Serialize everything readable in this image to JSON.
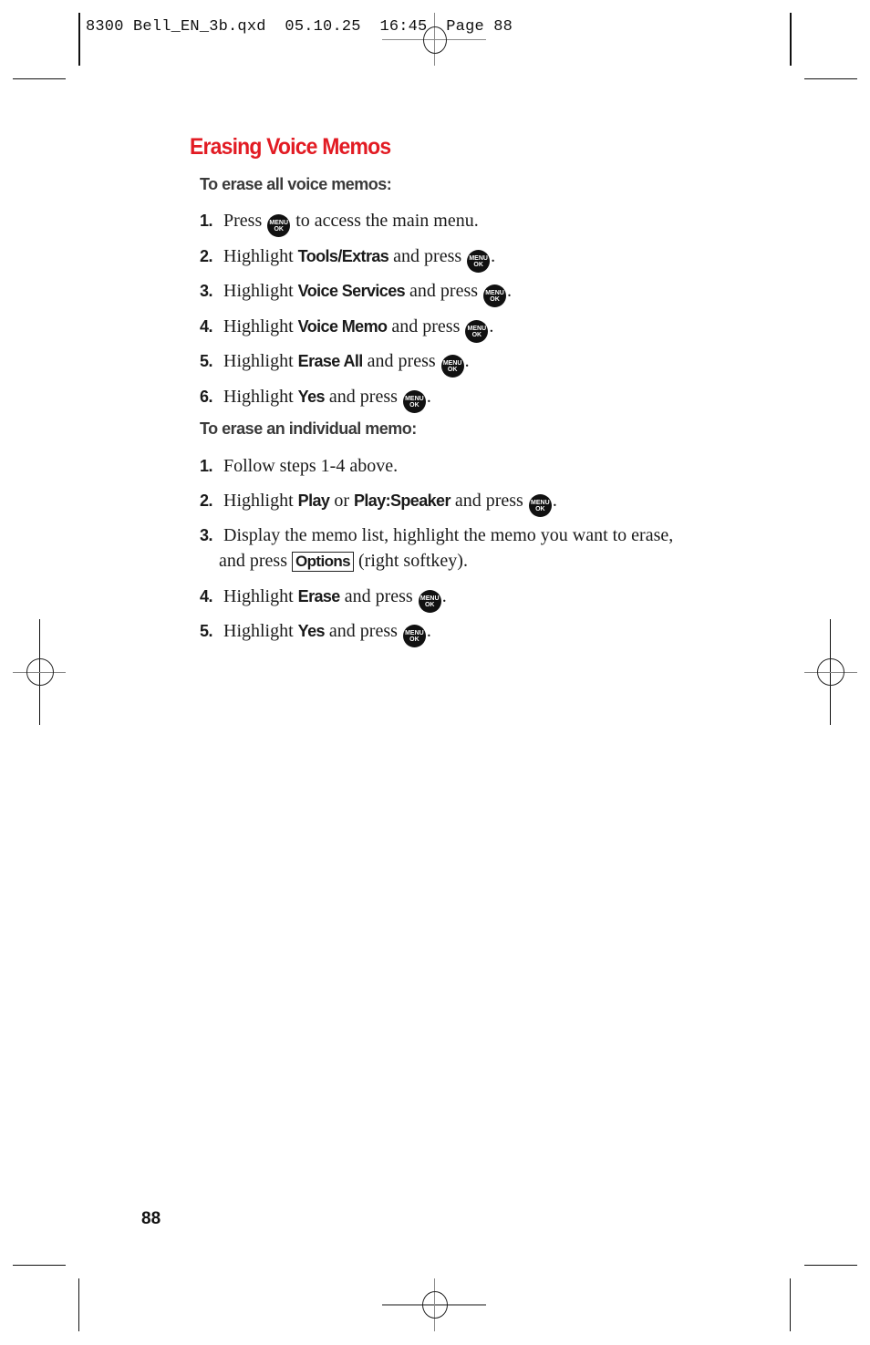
{
  "slug_line": "8300 Bell_EN_3b.qxd  05.10.25  16:45  Page 88",
  "title": "Erasing Voice Memos",
  "menu_button": {
    "line1": "MENU",
    "line2": "OK",
    "icon": "menu-ok-key-icon"
  },
  "section_all": {
    "heading": "To erase all voice memos:",
    "steps": [
      {
        "num": "1.",
        "pre": "Press",
        "key": "",
        "mid": "",
        "key2": "",
        "post": "to access the main menu.",
        "has_button": true
      },
      {
        "num": "2.",
        "pre": "Highlight",
        "key": "Tools/Extras",
        "post": "and press",
        "has_button": true,
        "end": "."
      },
      {
        "num": "3.",
        "pre": "Highlight",
        "key": "Voice Services",
        "post": "and press",
        "has_button": true,
        "end": "."
      },
      {
        "num": "4.",
        "pre": "Highlight",
        "key": "Voice Memo",
        "post": "and press",
        "has_button": true,
        "end": "."
      },
      {
        "num": "5.",
        "pre": "Highlight",
        "key": "Erase All",
        "post": "and press",
        "has_button": true,
        "end": "."
      },
      {
        "num": "6.",
        "pre": "Highlight",
        "key": "Yes",
        "post": "and press",
        "has_button": true,
        "end": "."
      }
    ]
  },
  "section_individual": {
    "heading": "To erase an individual memo:",
    "steps": [
      {
        "num": "1.",
        "text": "Follow steps 1-4 above."
      },
      {
        "num": "2.",
        "pre": "Highlight",
        "key": "Play",
        "mid": "or",
        "key2": "Play:Speaker",
        "post": "and press",
        "end": "."
      },
      {
        "num": "3.",
        "line1": "Display the memo list, highlight the memo you want to erase,",
        "line2_pre": "and press",
        "softkey": "Options",
        "line2_post": "(right softkey)."
      },
      {
        "num": "4.",
        "pre": "Highlight",
        "key": "Erase",
        "post": "and press",
        "end": "."
      },
      {
        "num": "5.",
        "pre": "Highlight",
        "key": "Yes",
        "post": "and press",
        "end": "."
      }
    ]
  },
  "page_number": "88"
}
